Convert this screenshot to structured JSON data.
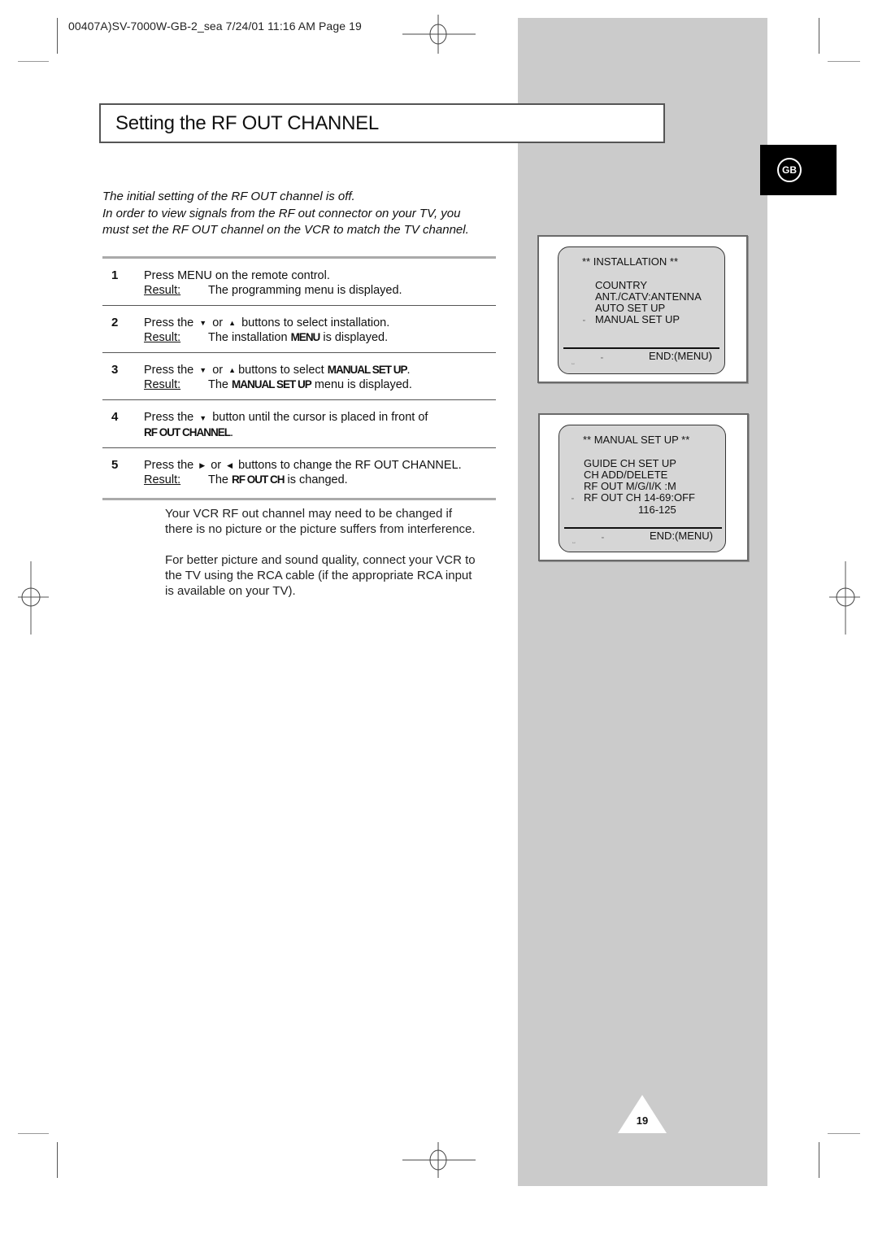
{
  "print_header": "00407A)SV-7000W-GB-2_sea  7/24/01 11:16 AM  Page 19",
  "title": "Setting the RF OUT CHANNEL",
  "language_badge": "GB",
  "intro": {
    "line1": "The initial setting of the RF OUT channel is off.",
    "line2": "In order to view signals from the RF out connector on your TV, you",
    "line3": "must set the RF OUT channel on the VCR to match the TV channel."
  },
  "steps": [
    {
      "number": "1",
      "instruction": "Press MENU on the remote control.",
      "result_label": "Result:",
      "result": "The programming menu is displayed."
    },
    {
      "number": "2",
      "instruction_pre": "Press the",
      "arrow1": "down-arrow-icon",
      "or": "or",
      "arrow2": "up-arrow-icon",
      "instruction_post": "buttons to select installation.",
      "result_label": "Result:",
      "result_pre": "The installation",
      "result_bold": "MENU",
      "result_post": "is displayed."
    },
    {
      "number": "3",
      "instruction_pre": "Press the",
      "or": "or",
      "instruction_mid": "buttons to select",
      "instruction_bold": "MANUAL SET UP",
      "instruction_end": ".",
      "result_label": "Result:",
      "result_pre": "The",
      "result_bold": "MANUAL SET UP",
      "result_post": "menu is displayed."
    },
    {
      "number": "4",
      "instruction_pre": "Press the",
      "instruction_post": "button until the cursor is placed in front of",
      "instruction_bold": "RF OUT CHANNEL",
      "instruction_end": "."
    },
    {
      "number": "5",
      "instruction_pre": "Press the",
      "or": "or",
      "instruction_post": "buttons to change the RF OUT CHANNEL.",
      "result_label": "Result:",
      "result_pre": "The",
      "result_bold": "RF OUT CH",
      "result_post": "is changed."
    }
  ],
  "notes": {
    "note1_line1": "Your VCR RF out channel may need to be changed if",
    "note1_line2": "there is no picture or the picture suffers from interference.",
    "note2_line1": "For better picture and sound quality, connect your VCR to",
    "note2_line2": "the TV using the RCA cable (if the appropriate RCA input",
    "note2_line3": "is available on your TV)."
  },
  "screens": [
    {
      "header": "**   INSTALLATION  **",
      "items": [
        "COUNTRY",
        "ANT./CATV:ANTENNA",
        "AUTO SET UP",
        "MANUAL SET UP"
      ],
      "selected_index": 3,
      "footer": "END:(MENU)"
    },
    {
      "header": "**   MANUAL SET UP **",
      "items": [
        "GUIDE CH SET UP",
        "CH ADD/DELETE",
        "RF OUT M/G/I/K :M",
        "RF OUT CH 14-69:OFF",
        "116-125"
      ],
      "selected_index": 3,
      "footer": "END:(MENU)"
    }
  ],
  "icons": {
    "cursor": "▫",
    "down_arrow": "▼",
    "up_arrow": "▲",
    "left_arrow": "◀",
    "right_arrow": "▶"
  },
  "page_number": "19"
}
